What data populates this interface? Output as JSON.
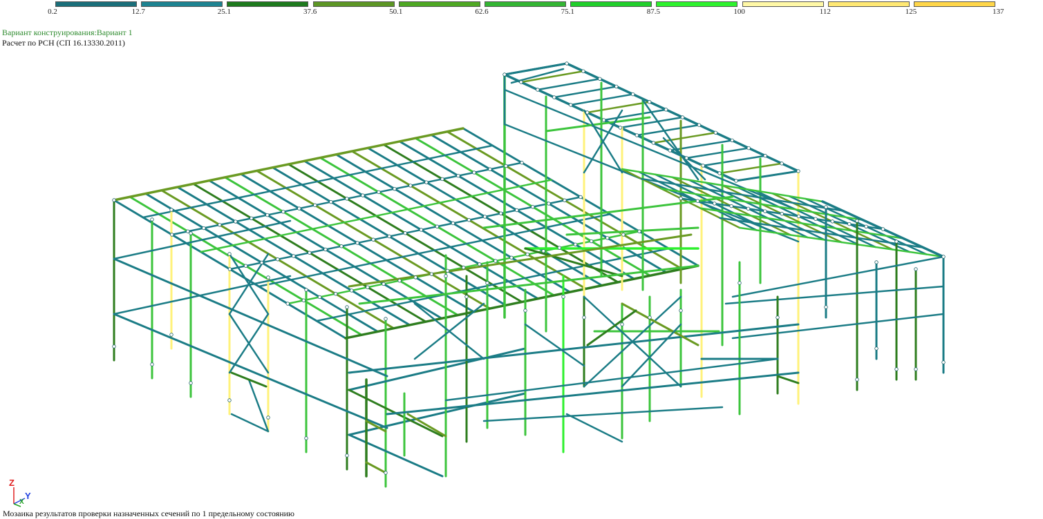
{
  "legend": {
    "ticks": [
      "0.2",
      "12.7",
      "25.1",
      "37.6",
      "50.1",
      "62.6",
      "75.1",
      "87.5",
      "100",
      "112",
      "125",
      "137"
    ],
    "colors": [
      "#1a6f7a",
      "#1d8391",
      "#1d7a1d",
      "#5c9624",
      "#4ea823",
      "#33b533",
      "#20cf2b",
      "#2df22d",
      "#fff8a6",
      "#ffe873",
      "#ffd649"
    ]
  },
  "header": {
    "variant": "Вариант конструирования:Вариант 1",
    "calc": "Расчет по РСН (СП 16.13330.2011)"
  },
  "axes": {
    "z": "Z",
    "y": "Y",
    "x": "X"
  },
  "footer": {
    "caption": "Мозаика результатов проверки назначенных сечений по 1 предельному состоянию"
  },
  "palette": {
    "teal": "#1b7c86",
    "dark_green": "#2e7d1e",
    "olive": "#6a9a22",
    "green": "#3cc43c",
    "bright_green": "#2ef02e",
    "yellow": "#fff27a"
  }
}
